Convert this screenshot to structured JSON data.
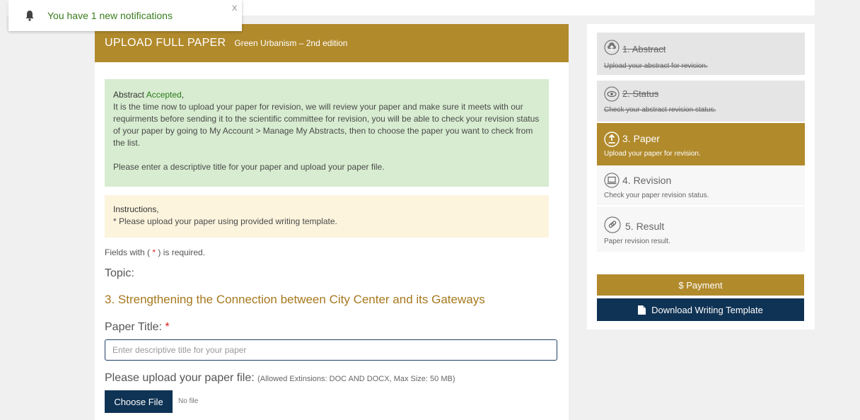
{
  "notification": {
    "text": "You have 1 new notifications",
    "close": "X"
  },
  "header": {
    "title": "UPLOAD FULL PAPER",
    "subtitle": "Green Urbanism – 2nd edition"
  },
  "alert_success": {
    "title_prefix": "Abstract ",
    "title_accepted": "Accepted",
    "title_suffix": ",",
    "body": "It is the time now to upload your paper for revision, we will review your paper and make sure it meets with our requirments before sending it to the scientific committee for revision, you will be able to check your revision status of your paper by going to My Account > Manage My Abstracts, then to choose the paper you want to check from the list.",
    "body2": "Please enter a descriptive title for your paper and upload your paper file."
  },
  "alert_info": {
    "title": "Instructions,",
    "body": "* Please upload your paper using provided writing template."
  },
  "form": {
    "required_note_pre": "Fields with ( ",
    "required_star": "*",
    "required_note_post": " ) is required.",
    "topic_label": "Topic:",
    "topic_value": "3. Strengthening the Connection between City Center and its Gateways",
    "paper_title_label": "Paper Title: ",
    "paper_title_star": "*",
    "paper_title_placeholder": "Enter descriptive title for your paper",
    "upload_label": "Please upload your paper file: ",
    "upload_hint": "(Allowed Extinsions: DOC AND DOCX, Max Size: 50 MB)",
    "choose_file": "Choose File",
    "no_file": "No file"
  },
  "steps": [
    {
      "title": "1. Abstract",
      "sub": "Upload your abstract for revision.",
      "state": "done",
      "icon": "cloud-upload-icon"
    },
    {
      "title": "2. Status",
      "sub": "Check your abstract revision status.",
      "state": "done",
      "icon": "eye-icon"
    },
    {
      "title": "3. Paper",
      "sub": "Upload your paper for revision.",
      "state": "active",
      "icon": "upload-circle-icon"
    },
    {
      "title": "4. Revision",
      "sub": "Check your paper revision status.",
      "state": "pending",
      "icon": "laptop-icon"
    },
    {
      "title": "5. Result",
      "sub": "Paper revision result.",
      "state": "pending",
      "icon": "link-icon"
    }
  ],
  "sidebar_buttons": {
    "payment": "$ Payment",
    "download": "Download Writing Template"
  },
  "colors": {
    "gold": "#b18a2c",
    "navy": "#0f3354",
    "success_bg": "#d7ecd0",
    "info_bg": "#fcf4dd"
  }
}
